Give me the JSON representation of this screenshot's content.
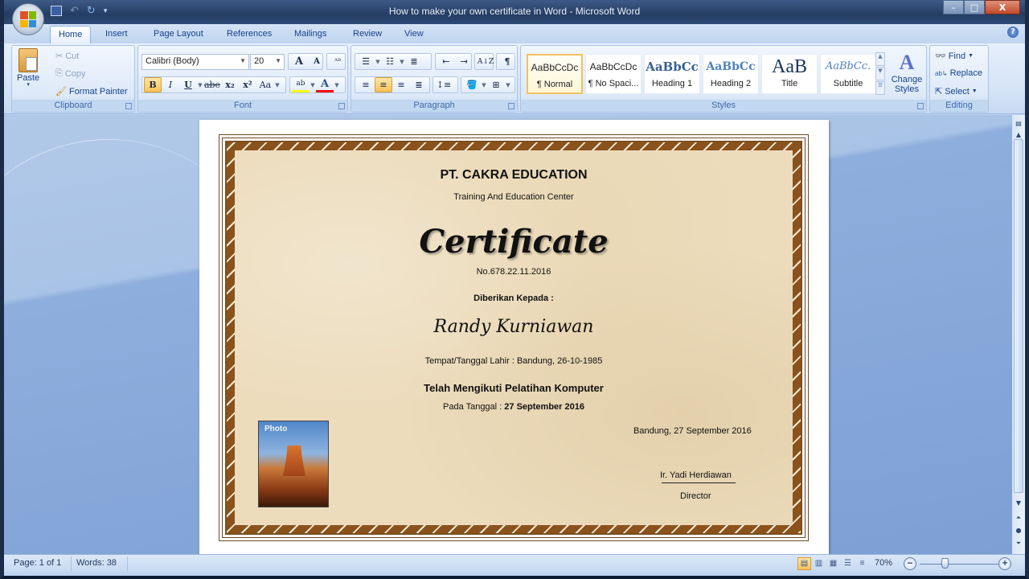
{
  "window": {
    "title": "How to make your own certificate in Word - Microsoft Word",
    "controls": {
      "minimize": "–",
      "maximize": "□",
      "close": "X"
    }
  },
  "quick_access": {
    "save_icon": "save-icon",
    "undo_icon": "undo-icon",
    "redo_icon": "redo-icon",
    "customize_icon": "chevron-down-icon"
  },
  "tabs": [
    {
      "label": "Home",
      "active": true
    },
    {
      "label": "Insert"
    },
    {
      "label": "Page Layout"
    },
    {
      "label": "References"
    },
    {
      "label": "Mailings"
    },
    {
      "label": "Review"
    },
    {
      "label": "View"
    }
  ],
  "ribbon": {
    "clipboard": {
      "label": "Clipboard",
      "paste": "Paste",
      "cut": "Cut",
      "copy": "Copy",
      "format_painter": "Format Painter"
    },
    "font": {
      "label": "Font",
      "font_name": "Calibri (Body)",
      "font_size": "20",
      "grow": "A",
      "shrink": "A",
      "bold": "B",
      "italic": "I",
      "underline": "U",
      "strikethrough": "abe",
      "subscript": "x₂",
      "superscript": "x²",
      "change_case": "Aa",
      "font_color": "A"
    },
    "paragraph": {
      "label": "Paragraph",
      "show_marks": "¶",
      "sort": "A↓Z",
      "alignment": "center"
    },
    "styles": {
      "label": "Styles",
      "items": [
        {
          "preview": "AaBbCcDc",
          "name": "¶ Normal",
          "selected": true
        },
        {
          "preview": "AaBbCcDc",
          "name": "¶ No Spaci..."
        },
        {
          "preview": "AaBbCc",
          "name": "Heading 1"
        },
        {
          "preview": "AaBbCc",
          "name": "Heading 2"
        },
        {
          "preview": "AaB",
          "name": "Title"
        },
        {
          "preview": "AaBbCc.",
          "name": "Subtitle"
        }
      ],
      "change_styles": "Change Styles"
    },
    "editing": {
      "label": "Editing",
      "find": "Find",
      "replace": "Replace",
      "select": "Select"
    }
  },
  "certificate": {
    "company": "PT. CAKRA EDUCATION",
    "subtitle": "Training And Education Center",
    "heading": "Certificate",
    "number": "No.678.22.11.2016",
    "given_to_label": "Diberikan Kepada :",
    "recipient": "Randy Kurniawan",
    "birth_info": "Tempat/Tanggal Lahir : Bandung, 26-10-1985",
    "course": "Telah Mengikuti Pelatihan Komputer",
    "date_label": "Pada Tanggal :",
    "date_value": "27 September 2016",
    "photo_label": "Photo",
    "place_date": "Bandung, 27 September 2016",
    "signer": "Ir. Yadi Herdiawan",
    "signer_title": "Director"
  },
  "status_bar": {
    "page": "Page: 1 of 1",
    "words": "Words: 38",
    "zoom": "70%",
    "zoom_level_percent": 70,
    "active_view": "print-layout"
  }
}
